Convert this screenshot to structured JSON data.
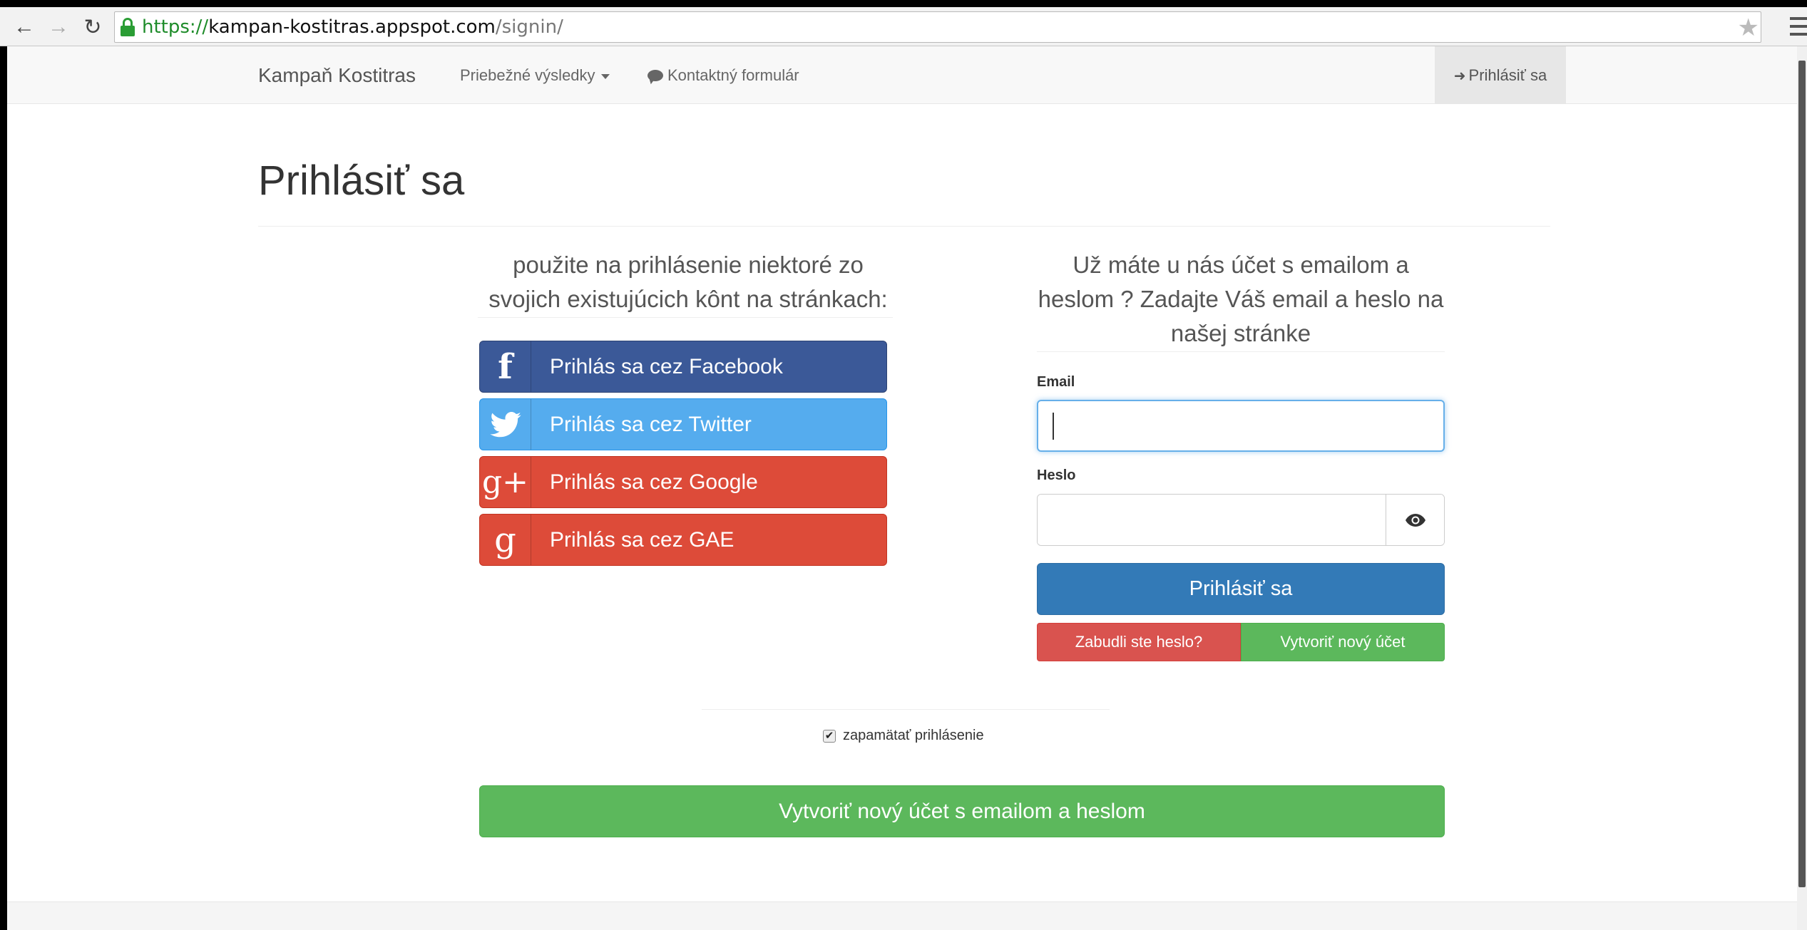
{
  "browser": {
    "url_scheme": "https://",
    "url_host": "kampan-kostitras.appspot.com",
    "url_path": "/signin/"
  },
  "navbar": {
    "brand": "Kampaň Kostitras",
    "results_label": "Priebežné výsledky",
    "contact_label": "Kontaktný formulár",
    "signin_label": "Prihlásiť sa"
  },
  "page": {
    "title": "Prihlásiť sa"
  },
  "social": {
    "intro": "použite na prihlásenie niektoré zo svojich existujúcich kônt na stránkach:",
    "buttons": [
      {
        "icon": "f",
        "label": "Prihlás sa cez Facebook"
      },
      {
        "icon": "",
        "label": "Prihlás sa cez Twitter"
      },
      {
        "icon": "g+",
        "label": "Prihlás sa cez Google"
      },
      {
        "icon": "g",
        "label": "Prihlás sa cez GAE"
      }
    ]
  },
  "email_login": {
    "intro": "Už máte u nás účet s emailom a heslom ? Zadajte Váš email a heslo na našej stránke",
    "email_label": "Email",
    "email_value": "",
    "password_label": "Heslo",
    "password_value": "",
    "submit_label": "Prihlásiť sa",
    "forgot_label": "Zabudli ste heslo?",
    "create_label": "Vytvoriť nový účet"
  },
  "remember": {
    "label": "zapamätať prihlásenie",
    "checked": true
  },
  "create_account": {
    "label": "Vytvoriť nový účet s emailom a heslom"
  },
  "colors": {
    "facebook": "#3b5998",
    "twitter": "#55acee",
    "google": "#dd4b39",
    "primary": "#337ab7",
    "success": "#5cb85c",
    "danger": "#d9534f"
  }
}
